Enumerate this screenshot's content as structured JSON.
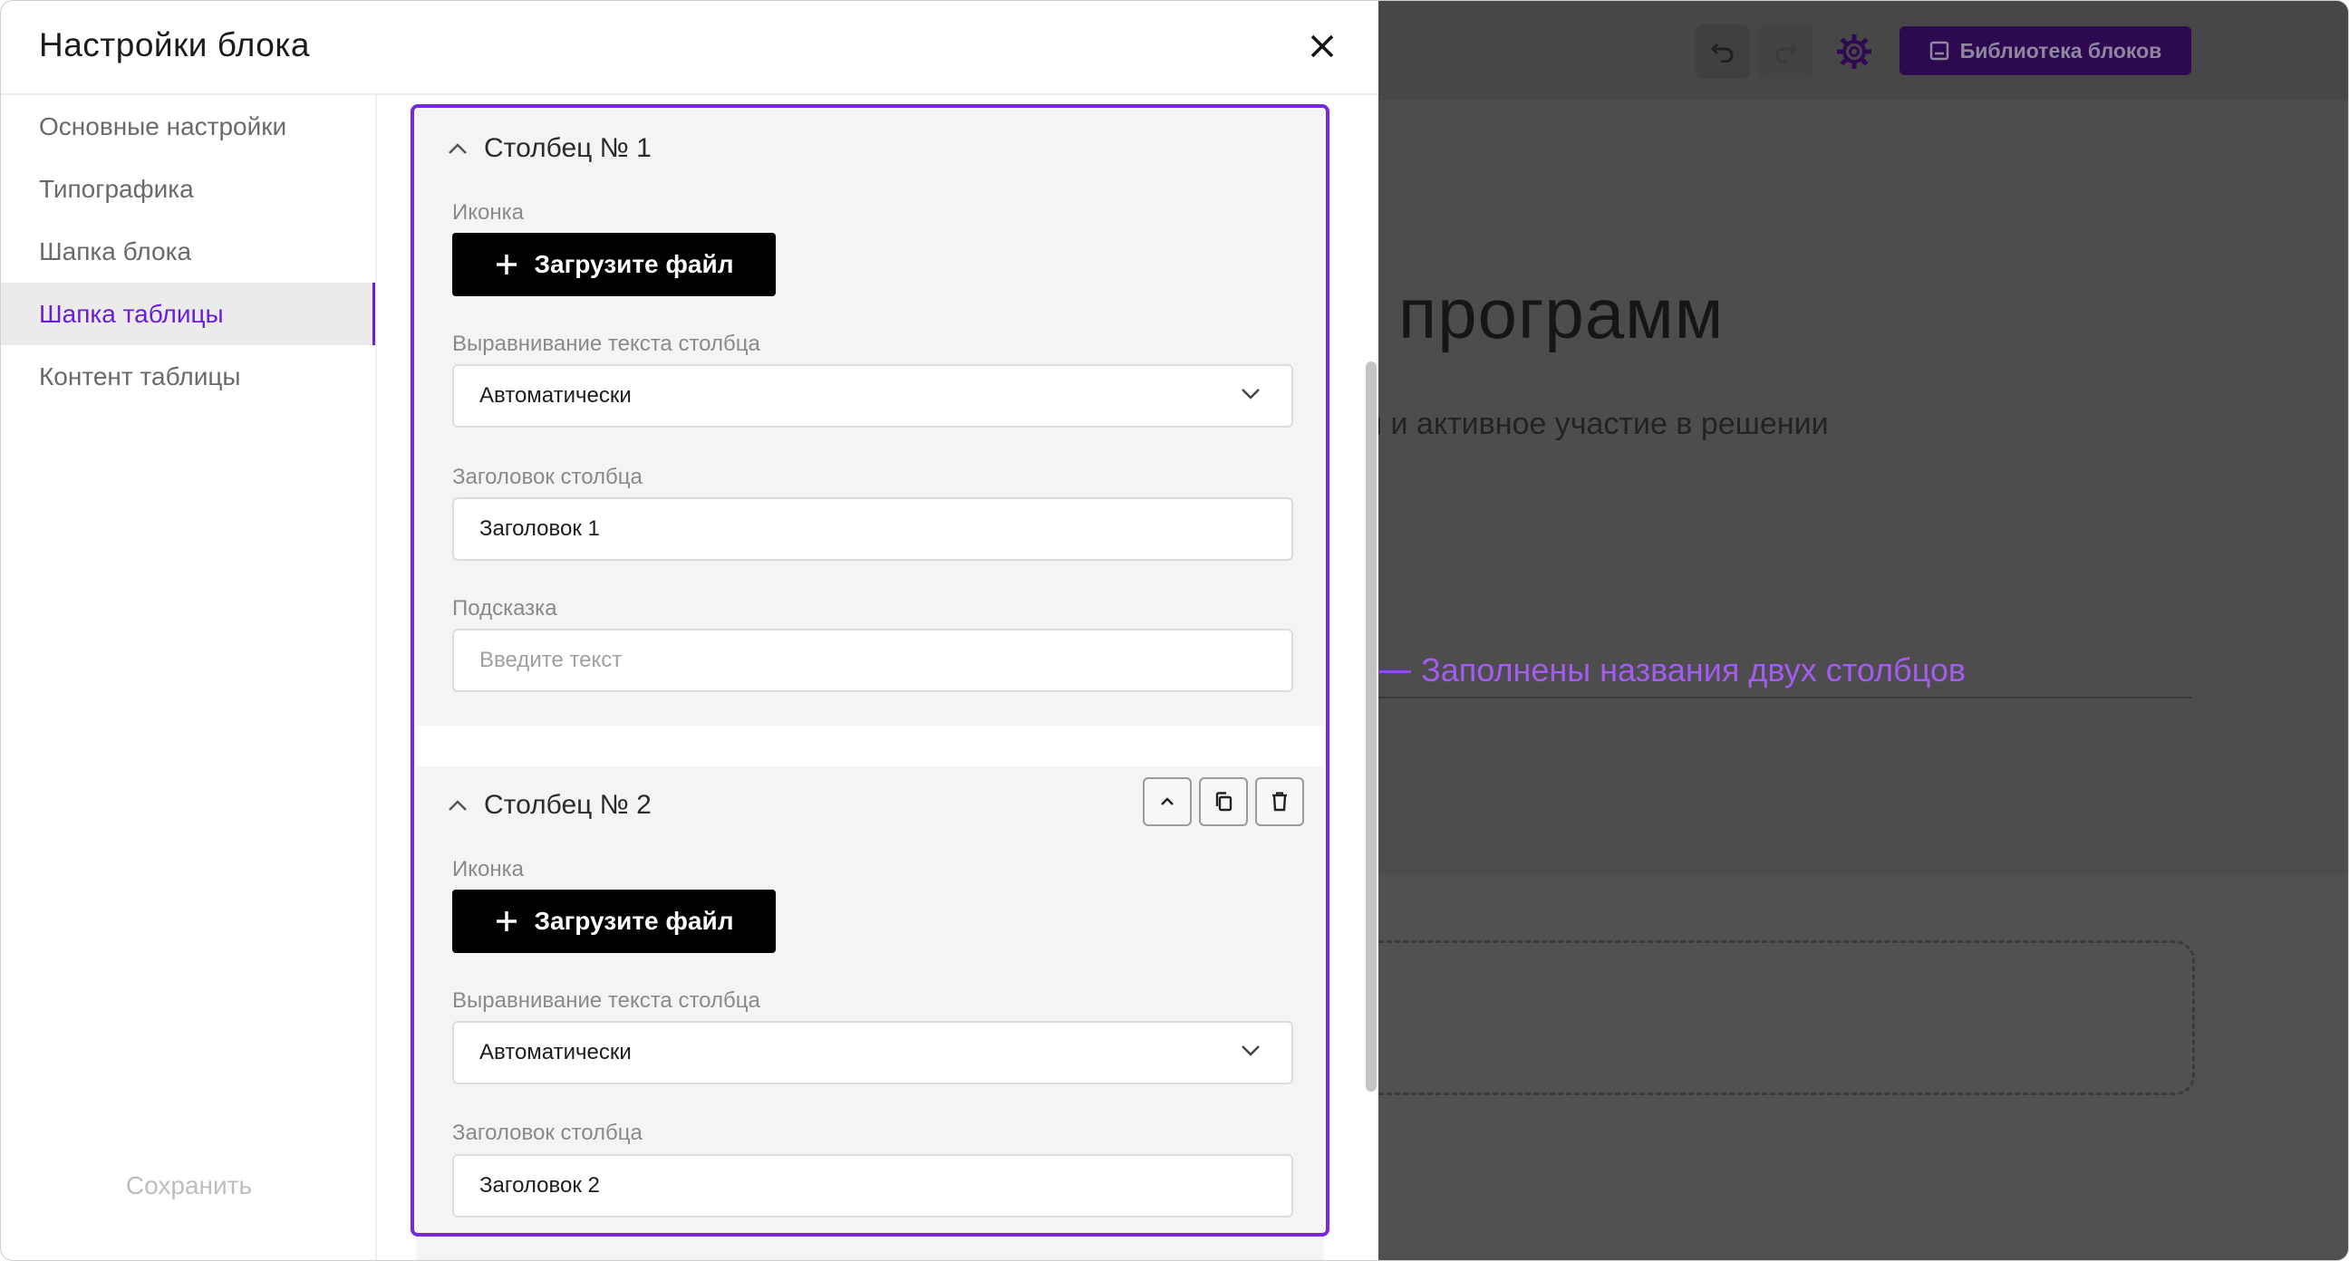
{
  "modal": {
    "title": "Настройки блока",
    "close_icon": "close-icon"
  },
  "sidebar": {
    "items": [
      {
        "label": "Основные настройки",
        "active": false
      },
      {
        "label": "Типографика",
        "active": false
      },
      {
        "label": "Шапка блока",
        "active": false
      },
      {
        "label": "Шапка таблицы",
        "active": true
      },
      {
        "label": "Контент таблицы",
        "active": false
      }
    ],
    "save_label": "Сохранить"
  },
  "columns": [
    {
      "heading": "Столбец № 1",
      "icon_label": "Иконка",
      "upload_label": "Загрузите файл",
      "align_label": "Выравнивание текста столбца",
      "align_value": "Автоматически",
      "title_label": "Заголовок столбца",
      "title_value": "Заголовок 1",
      "hint_label": "Подсказка",
      "hint_placeholder": "Введите текст"
    },
    {
      "heading": "Столбец № 2",
      "icon_label": "Иконка",
      "upload_label": "Загрузите файл",
      "align_label": "Выравнивание текста столбца",
      "align_value": "Автоматически",
      "title_label": "Заголовок столбца",
      "title_value": "Заголовок 2"
    }
  ],
  "annotation": {
    "text": "Заполнены названия двух столбцов",
    "color": "#a45cf0"
  },
  "background": {
    "library_button": "Библиотека блоков",
    "title_fragment": "льных программ",
    "subtitle_fragment": "е возможности и активное участие в решении"
  },
  "colors": {
    "accent": "#6a1ed8",
    "highlight_border": "#7b27e0",
    "upload_button": "#000000"
  }
}
